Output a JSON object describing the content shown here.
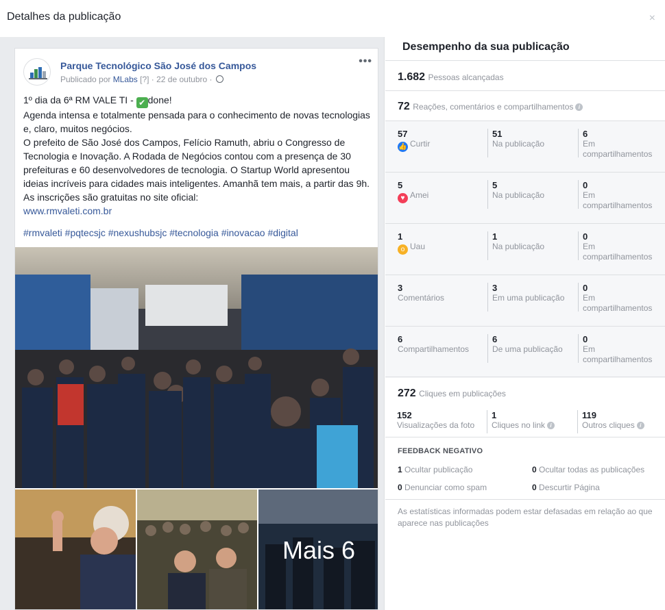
{
  "dialog": {
    "title": "Detalhes da publicação",
    "close": "×"
  },
  "post": {
    "page_name": "Parque Tecnológico São José dos Campos",
    "published_by_prefix": "Publicado por",
    "publisher": "MLabs",
    "publisher_help": "[?]",
    "date": "· 22 de outubro ·",
    "more": "•••",
    "line1_pre": "1º dia da 6ª RM VALE TI -",
    "line1_post": "done!",
    "paragraph1": "Agenda intensa e totalmente pensada para o conhecimento de novas tecnologias e, claro, muitos negócios.",
    "paragraph2": "O prefeito de São José dos Campos, Felício Ramuth, abriu o Congresso de Tecnologia e Inovação. A Rodada de Negócios contou com a presença de 30 prefeituras e 60 desenvolvedores de tecnologia. O Startup World apresentou ideias incríveis para cidades mais inteligentes. Amanhã tem mais, a partir das 9h. As inscrições são gratuitas no site oficial:",
    "link": "www.rmvaleti.com.br",
    "hashtags": "#rmvaleti #pqtecsjc #nexushubsjc #tecnologia #inovacao #digital",
    "more_photos": "Mais 6"
  },
  "performance": {
    "title": "Desempenho da sua publicação",
    "reach_value": "1.682",
    "reach_label": "Pessoas alcançadas",
    "engagement_value": "72",
    "engagement_label": "Reações, comentários e compartilhamentos",
    "rows": [
      {
        "total": "57",
        "label": "Curtir",
        "on_post": "51",
        "on_post_label": "Na publicação",
        "shares": "6",
        "shares_label": "Em compartilhamentos"
      },
      {
        "total": "5",
        "label": "Amei",
        "on_post": "5",
        "on_post_label": "Na publicação",
        "shares": "0",
        "shares_label": "Em compartilhamentos"
      },
      {
        "total": "1",
        "label": "Uau",
        "on_post": "1",
        "on_post_label": "Na publicação",
        "shares": "0",
        "shares_label": "Em compartilhamentos"
      },
      {
        "total": "3",
        "label": "Comentários",
        "on_post": "3",
        "on_post_label": "Em uma publicação",
        "shares": "0",
        "shares_label": "Em compartilhamentos"
      },
      {
        "total": "6",
        "label": "Compartilhamentos",
        "on_post": "6",
        "on_post_label": "De uma publicação",
        "shares": "0",
        "shares_label": "Em compartilhamentos"
      }
    ],
    "clicks_value": "272",
    "clicks_label": "Cliques em publicações",
    "photo_views_value": "152",
    "photo_views_label": "Visualizações da foto",
    "link_clicks_value": "1",
    "link_clicks_label": "Cliques no link",
    "other_clicks_value": "119",
    "other_clicks_label": "Outros cliques",
    "negative_title": "FEEDBACK NEGATIVO",
    "hide_post_value": "1",
    "hide_post_label": "Ocultar publicação",
    "hide_all_value": "0",
    "hide_all_label": "Ocultar todas as publicações",
    "spam_value": "0",
    "spam_label": "Denunciar como spam",
    "unlike_value": "0",
    "unlike_label": "Descurtir Página",
    "note": "As estatísticas informadas podem estar defasadas em relação ao que aparece nas publicações"
  },
  "colors": {
    "link": "#365899",
    "like": "#2078f4",
    "love": "#f33e58",
    "wow": "#f7b125",
    "done": "#4caf50"
  }
}
